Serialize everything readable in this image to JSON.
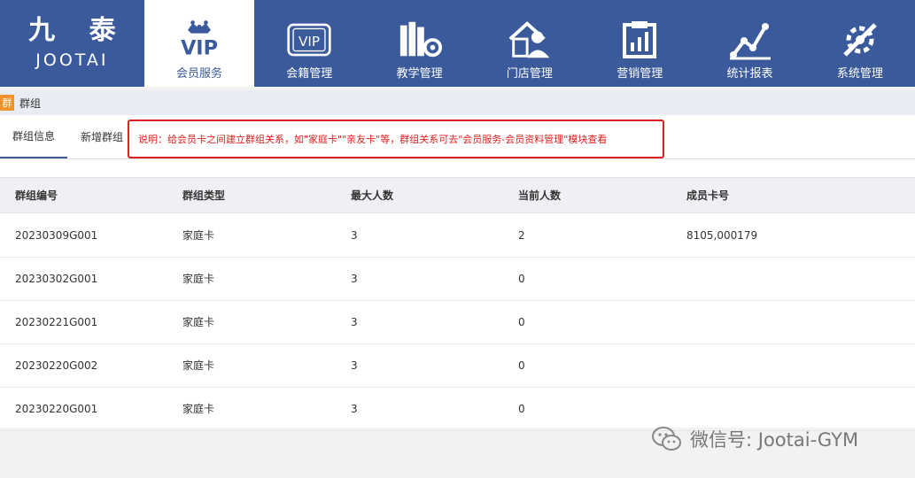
{
  "logo": {
    "cn": "九 泰",
    "en": "JOOTAI"
  },
  "nav": [
    {
      "label": "会员服务",
      "icon": "vip-crown-icon",
      "active": true
    },
    {
      "label": "会籍管理",
      "icon": "vip-card-icon"
    },
    {
      "label": "教学管理",
      "icon": "books-gear-icon"
    },
    {
      "label": "门店管理",
      "icon": "store-person-icon"
    },
    {
      "label": "营销管理",
      "icon": "chart-clipboard-icon"
    },
    {
      "label": "统计报表",
      "icon": "line-graph-icon"
    },
    {
      "label": "系统管理",
      "icon": "tools-icon"
    }
  ],
  "breadcrumb": {
    "badge": "群",
    "title": "群组"
  },
  "tabs": [
    {
      "label": "群组信息",
      "active": true
    },
    {
      "label": "新增群组"
    }
  ],
  "notice": "说明：给会员卡之间建立群组关系，如\"家庭卡\"\"亲友卡\"等，群组关系可去\"会员服务-会员资料管理\"模块查看",
  "table": {
    "headers": [
      "群组编号",
      "群组类型",
      "最大人数",
      "当前人数",
      "成员卡号"
    ],
    "rows": [
      [
        "20230309G001",
        "家庭卡",
        "3",
        "2",
        "8105,000179"
      ],
      [
        "20230302G001",
        "家庭卡",
        "3",
        "0",
        ""
      ],
      [
        "20230221G001",
        "家庭卡",
        "3",
        "0",
        ""
      ],
      [
        "20230220G002",
        "家庭卡",
        "3",
        "0",
        ""
      ],
      [
        "20230220G001",
        "家庭卡",
        "3",
        "0",
        ""
      ]
    ]
  },
  "watermark": {
    "text": "微信号: Jootai-GYM",
    "icon": "wechat-icon"
  },
  "colors": {
    "nav_bg": "#3a5a9b",
    "notice_red": "#e02020",
    "badge_orange": "#f0932b"
  }
}
